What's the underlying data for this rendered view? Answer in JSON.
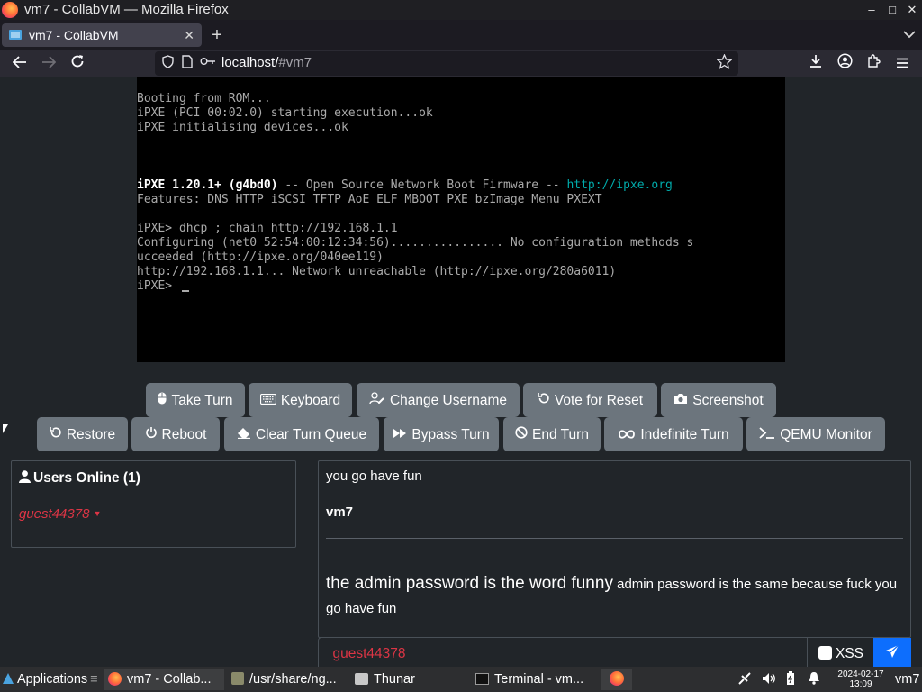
{
  "window": {
    "title": "vm7 - CollabVM — Mozilla Firefox",
    "min": "–",
    "max": "□",
    "close": "✕"
  },
  "tab": {
    "label": "vm7 - CollabVM",
    "close": "✕",
    "new": "+"
  },
  "nav": {
    "url_host": "localhost/",
    "url_path": "#vm7"
  },
  "vm_screen": {
    "lines": [
      {
        "t": ""
      },
      {
        "t": "Booting from ROM..."
      },
      {
        "t": "iPXE (PCI 00:02.0) starting execution...ok"
      },
      {
        "t": "iPXE initialising devices...ok"
      },
      {
        "t": ""
      },
      {
        "t": ""
      },
      {
        "t": ""
      },
      {
        "t": "iPXE 1.20.1+ (g4bd0)",
        "bold": true,
        "rest": " -- Open Source Network Boot Firmware -- ",
        "link": "http://ipxe.org"
      },
      {
        "t": "Features: DNS HTTP iSCSI TFTP AoE ELF MBOOT PXE bzImage Menu PXEXT"
      },
      {
        "t": ""
      },
      {
        "t": "iPXE> dhcp ; chain http://192.168.1.1"
      },
      {
        "t": "Configuring (net0 52:54:00:12:34:56)................ No configuration methods s"
      },
      {
        "t": "ucceeded (http://ipxe.org/040ee119)"
      },
      {
        "t": "http://192.168.1.1... Network unreachable (http://ipxe.org/280a6011)"
      },
      {
        "t": "iPXE> ",
        "cursor": true
      }
    ]
  },
  "buttons": {
    "take_turn": "Take Turn",
    "keyboard": "Keyboard",
    "change_username": "Change Username",
    "vote_reset": "Vote for Reset",
    "screenshot": "Screenshot",
    "restore": "Restore",
    "reboot": "Reboot",
    "clear_queue": "Clear Turn Queue",
    "bypass_turn": "Bypass Turn",
    "end_turn": "End Turn",
    "indefinite_turn": "Indefinite Turn",
    "qemu_monitor": "QEMU Monitor"
  },
  "users": {
    "header": "Users Online (1)",
    "list": [
      "guest44378"
    ]
  },
  "chat": {
    "msg1": "you go have fun",
    "sender": "vm7",
    "msg2_big": "the admin password is the word funny",
    "msg2_small": " admin password is the same because fuck you go have fun"
  },
  "input": {
    "username": "guest44378",
    "xss": "XSS",
    "placeholder": ""
  },
  "taskbar": {
    "apps": "Applications",
    "win1": "vm7 - Collab...",
    "win2": "/usr/share/ng...",
    "win3": "Thunar",
    "win4": "Terminal - vm...",
    "date": "2024-02-17",
    "time": "13:09",
    "user": "vm7"
  }
}
